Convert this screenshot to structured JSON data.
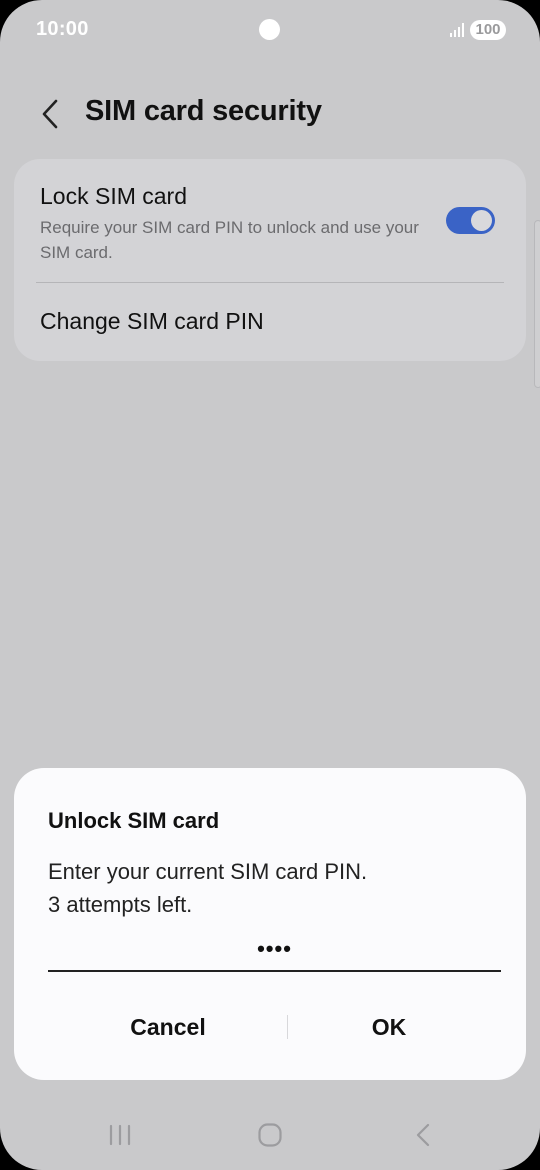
{
  "status_bar": {
    "time": "10:00",
    "battery_level": "100"
  },
  "header": {
    "title": "SIM card security"
  },
  "settings": {
    "lock_sim": {
      "title": "Lock SIM card",
      "description": "Require your SIM card PIN to unlock and use your SIM card.",
      "enabled": true
    },
    "change_pin": {
      "label": "Change SIM card PIN"
    }
  },
  "dialog": {
    "title": "Unlock SIM card",
    "message_line1": "Enter your current SIM card PIN.",
    "message_line2": "3 attempts left.",
    "pin_value": "••••",
    "cancel_label": "Cancel",
    "ok_label": "OK"
  },
  "nav_bar": {
    "recents_icon": "recents-icon",
    "home_icon": "home-icon",
    "back_icon": "back-icon"
  },
  "colors": {
    "accent": "#3a63c6",
    "background_dimmed": "#c9c9cb",
    "dialog_background": "#fbfbfd"
  }
}
